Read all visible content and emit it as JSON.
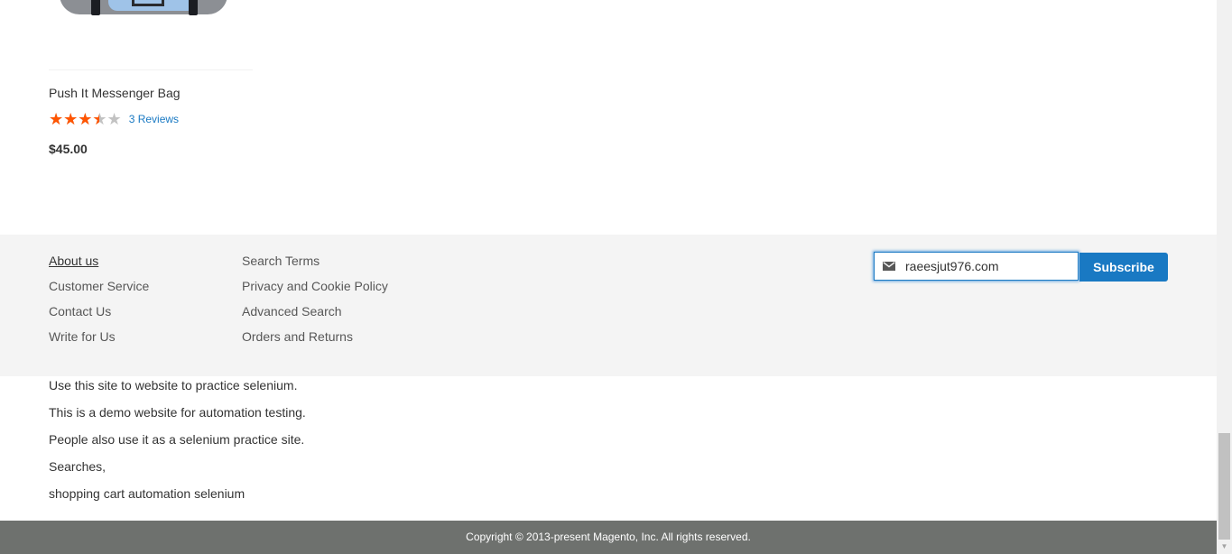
{
  "product": {
    "name": "Push It Messenger Bag",
    "rating": {
      "stars": "★★★★★",
      "value": 3.5,
      "max": 5
    },
    "reviews_label": "3 Reviews",
    "price": "$45.00"
  },
  "footer": {
    "links_col1": [
      "About us",
      "Customer Service",
      "Contact Us",
      "Write for Us"
    ],
    "links_col2": [
      "Search Terms",
      "Privacy and Cookie Policy",
      "Advanced Search",
      "Orders and Returns"
    ],
    "newsletter": {
      "email_value": "raeesjut976.com",
      "subscribe_label": "Subscribe",
      "icon": "envelope-icon"
    }
  },
  "site_text": [
    "Use this site to website to practice selenium.",
    "This is a demo website for automation testing.",
    "People also use it as a selenium practice site.",
    "Searches,",
    "shopping cart automation selenium"
  ],
  "copyright": "Copyright © 2013-present Magento, Inc. All rights reserved.",
  "colors": {
    "accent": "#1979c3",
    "star": "#ff5501",
    "footer_bg": "#f4f4f4",
    "copyright_bg": "#6e716e"
  }
}
